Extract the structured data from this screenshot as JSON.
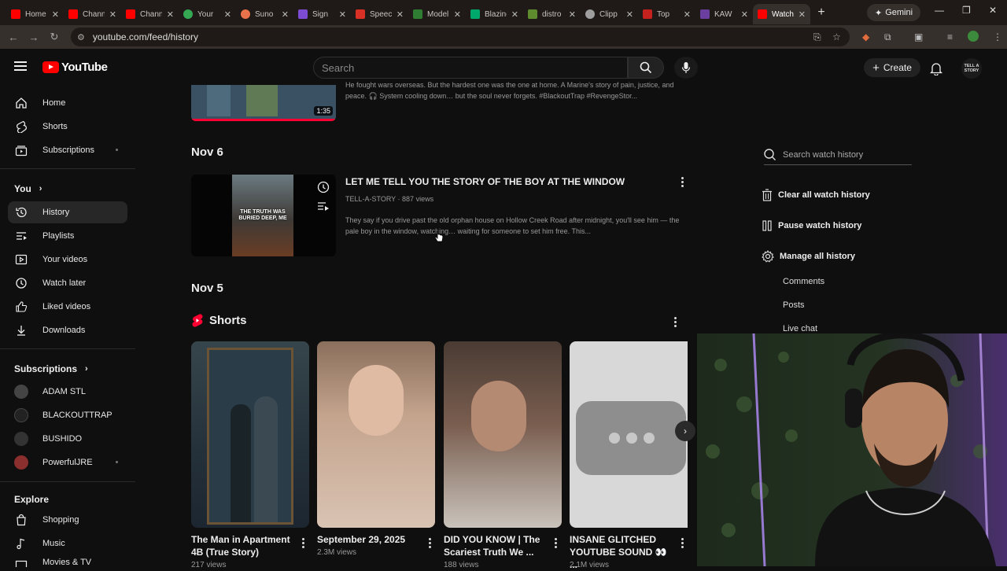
{
  "browser": {
    "tabs": [
      {
        "label": "Home",
        "color": "#ff0000"
      },
      {
        "label": "Channel",
        "color": "#ff0000"
      },
      {
        "label": "Channel",
        "color": "#ff0000"
      },
      {
        "label": "Your",
        "color": "#34a853"
      },
      {
        "label": "Suno",
        "color": "#e8734a"
      },
      {
        "label": "Sign",
        "color": "#7b4bd1"
      },
      {
        "label": "Speech",
        "color": "#d93025"
      },
      {
        "label": "Model",
        "color": "#2e7d32"
      },
      {
        "label": "Blazing",
        "color": "#00a86b"
      },
      {
        "label": "distro",
        "color": "#5f8b2f"
      },
      {
        "label": "Clipp",
        "color": "#9e9e9e"
      },
      {
        "label": "Top",
        "color": "#c5221f"
      },
      {
        "label": "KAW",
        "color": "#6b3fa0"
      },
      {
        "label": "Watch",
        "color": "#ff0000"
      }
    ],
    "gemini_label": "Gemini",
    "url": "youtube.com/feed/history"
  },
  "header": {
    "logo_text": "YouTube",
    "search_placeholder": "Search",
    "create_label": "Create",
    "avatar_text": "TELL A STORY"
  },
  "sidebar": {
    "main": [
      {
        "label": "Home",
        "icon": "home-icon"
      },
      {
        "label": "Shorts",
        "icon": "shorts-icon"
      },
      {
        "label": "Subscriptions",
        "icon": "subscriptions-icon"
      }
    ],
    "you_heading": "You",
    "you": [
      {
        "label": "History",
        "icon": "history-icon"
      },
      {
        "label": "Playlists",
        "icon": "playlists-icon"
      },
      {
        "label": "Your videos",
        "icon": "your-videos-icon"
      },
      {
        "label": "Watch later",
        "icon": "watch-later-icon"
      },
      {
        "label": "Liked videos",
        "icon": "like-icon"
      },
      {
        "label": "Downloads",
        "icon": "download-icon"
      }
    ],
    "subs_heading": "Subscriptions",
    "subs": [
      {
        "label": "ADAM STL",
        "color": "#444444"
      },
      {
        "label": "BLACKOUTTRAP",
        "color": "#222222"
      },
      {
        "label": "BUSHIDO",
        "color": "#333333"
      },
      {
        "label": "PowerfulJRE",
        "color": "#8b2e2e"
      }
    ],
    "explore_heading": "Explore",
    "explore": [
      {
        "label": "Shopping",
        "icon": "shopping-icon"
      },
      {
        "label": "Music",
        "icon": "music-icon"
      },
      {
        "label": "Movies & TV",
        "icon": "movies-icon"
      }
    ]
  },
  "history": {
    "prev_video": {
      "desc": "He fought wars overseas. But the hardest one was the one at home. A Marine's story of pain, justice, and peace. 🎧 System cooling down… but the soul never forgets. #BlackoutTrap #RevengeStor...",
      "duration": "1:35",
      "progress": 1.0
    },
    "date1": "Nov 6",
    "video": {
      "title": "LET ME TELL YOU THE STORY OF THE BOY AT THE WINDOW",
      "channel": "TELL-A-STORY",
      "views": "887 views",
      "desc": "They say if you drive past the old orphan house on Hollow Creek Road after midnight, you'll see him — the pale boy in the window, watching… waiting for someone to set him free. This...",
      "thumb_text": "THE TRUTH WAS BURIED DEEP, ME"
    },
    "date2": "Nov 5",
    "shorts_heading": "Shorts",
    "shorts": [
      {
        "title": "The Man in Apartment 4B (True Story)",
        "views": "217 views"
      },
      {
        "title": "September 29, 2025",
        "views": "2.3M views"
      },
      {
        "title": "DID YOU KNOW | The Scariest Truth We ...",
        "views": "188 views"
      },
      {
        "title": "INSANE GLITCHED YOUTUBE SOUND 👀 ...",
        "views": "2.1M views"
      }
    ]
  },
  "right_panel": {
    "search_placeholder": "Search watch history",
    "clear": "Clear all watch history",
    "pause": "Pause watch history",
    "manage": "Manage all history",
    "sub_items": [
      "Comments",
      "Posts",
      "Live chat"
    ]
  }
}
